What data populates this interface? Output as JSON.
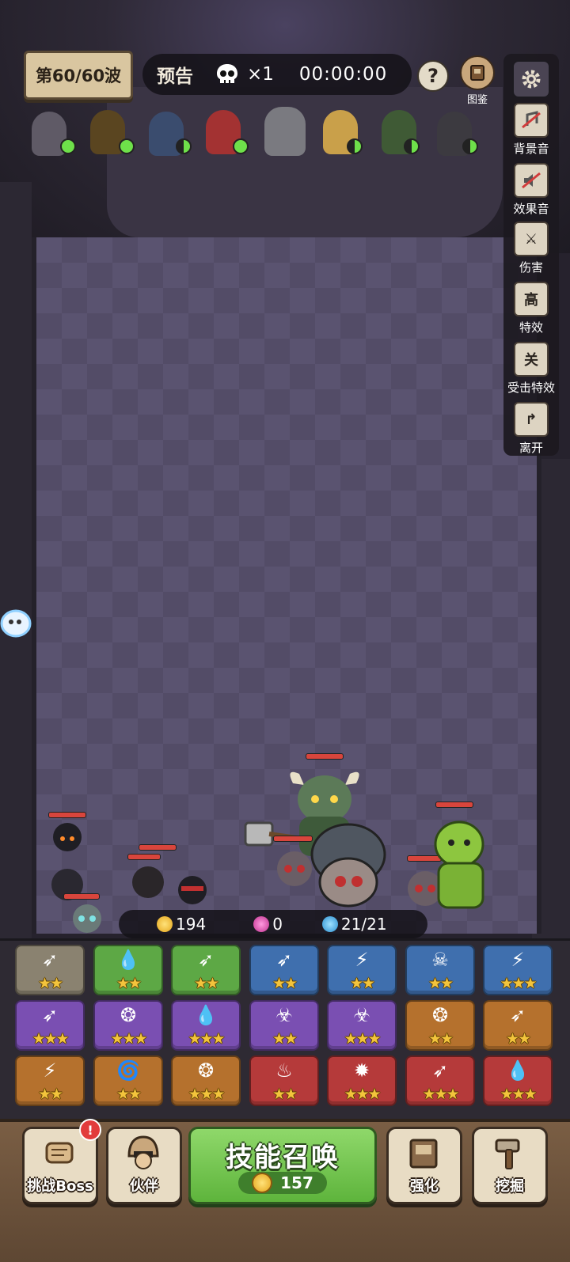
{
  "header": {
    "wave_label": "第60/60波",
    "forecast_label": "预告",
    "skull_count": "×1",
    "timer": "00:00:00",
    "help_label": "?",
    "codex_label": "图鉴"
  },
  "settings": {
    "items": [
      {
        "name": "bgm",
        "label": "背景音",
        "icon": "music-muted-icon",
        "glyph": ""
      },
      {
        "name": "sfx",
        "label": "效果音",
        "icon": "sound-muted-icon",
        "glyph": ""
      },
      {
        "name": "damage",
        "label": "伤害",
        "icon": "crossed-swords-icon",
        "glyph": "⚔"
      },
      {
        "name": "effects",
        "label": "特效",
        "icon": "quality-icon",
        "glyph": "高"
      },
      {
        "name": "hit-effects",
        "label": "受击特效",
        "icon": "toggle-icon",
        "glyph": "关"
      },
      {
        "name": "leave",
        "label": "离开",
        "icon": "exit-icon",
        "glyph": "↱"
      }
    ]
  },
  "resources": {
    "gold": "194",
    "gem": "0",
    "population": "21/21"
  },
  "skills": [
    {
      "bg": "#8a8270",
      "icon": "arrows",
      "glyph": "➶",
      "stars": "★★"
    },
    {
      "bg": "#5da845",
      "icon": "water",
      "glyph": "💧",
      "stars": "★★"
    },
    {
      "bg": "#5da845",
      "icon": "arrows",
      "glyph": "➶",
      "stars": "★★"
    },
    {
      "bg": "#3f6fae",
      "icon": "arrows",
      "glyph": "➶",
      "stars": "★★"
    },
    {
      "bg": "#3f6fae",
      "icon": "lightning",
      "glyph": "⚡",
      "stars": "★★"
    },
    {
      "bg": "#3f6fae",
      "icon": "ghost",
      "glyph": "☠",
      "stars": "★★"
    },
    {
      "bg": "#3f6fae",
      "icon": "lightning",
      "glyph": "⚡",
      "stars": "★★★"
    },
    {
      "bg": "#7a4fb2",
      "icon": "arrows",
      "glyph": "➶",
      "stars": "★★★"
    },
    {
      "bg": "#7a4fb2",
      "icon": "chain",
      "glyph": "❂",
      "stars": "★★★"
    },
    {
      "bg": "#7a4fb2",
      "icon": "water",
      "glyph": "💧",
      "stars": "★★★"
    },
    {
      "bg": "#7a4fb2",
      "icon": "poison",
      "glyph": "☣",
      "stars": "★★"
    },
    {
      "bg": "#7a4fb2",
      "icon": "poison",
      "glyph": "☣",
      "stars": "★★★"
    },
    {
      "bg": "#b5712d",
      "icon": "vortex",
      "glyph": "❂",
      "stars": "★★"
    },
    {
      "bg": "#b5712d",
      "icon": "arrows",
      "glyph": "➶",
      "stars": "★★"
    },
    {
      "bg": "#b5712d",
      "icon": "lightning",
      "glyph": "⚡",
      "stars": "★★"
    },
    {
      "bg": "#b5712d",
      "icon": "tornado",
      "glyph": "🌀",
      "stars": "★★"
    },
    {
      "bg": "#b5712d",
      "icon": "vortex",
      "glyph": "❂",
      "stars": "★★★"
    },
    {
      "bg": "#b53a3a",
      "icon": "flame",
      "glyph": "♨",
      "stars": "★★"
    },
    {
      "bg": "#b53a3a",
      "icon": "burst",
      "glyph": "✹",
      "stars": "★★★"
    },
    {
      "bg": "#b53a3a",
      "icon": "arrows",
      "glyph": "➶",
      "stars": "★★★"
    },
    {
      "bg": "#b53a3a",
      "icon": "water",
      "glyph": "💧",
      "stars": "★★★"
    }
  ],
  "bottom": {
    "challenge_label": "挑战Boss",
    "alert": "!",
    "partner_label": "伙伴",
    "summon_label": "技能召唤",
    "summon_cost": "157",
    "upgrade_label": "强化",
    "dig_label": "挖掘"
  },
  "colors": {
    "accent_green": "#6ee04a",
    "hp_red": "#d8453c",
    "summon_green": "#5eb43c",
    "star_gold": "#f3c43c"
  }
}
